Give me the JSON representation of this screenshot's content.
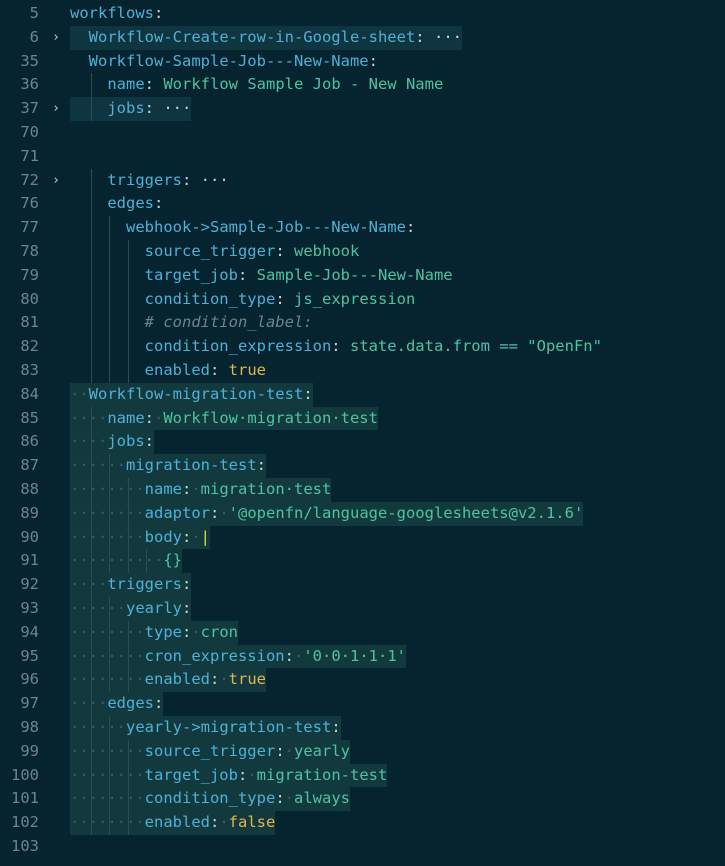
{
  "lines": [
    {
      "n": "5",
      "fold": "",
      "ind": 0,
      "k": "workflows",
      "v": "",
      "vt": "",
      "hl": false,
      "sel": false
    },
    {
      "n": "6",
      "fold": "›",
      "ind": 1,
      "k": "Workflow-Create-row-in-Google-sheet",
      "v": "···",
      "vt": "ell",
      "hl": true,
      "sel": false
    },
    {
      "n": "35",
      "fold": "",
      "ind": 1,
      "k": "Workflow-Sample-Job---New-Name",
      "v": "",
      "vt": "",
      "hl": false,
      "sel": false
    },
    {
      "n": "36",
      "fold": "",
      "ind": 2,
      "k": "name",
      "v": "Workflow Sample Job - New Name",
      "vt": "str",
      "hl": false,
      "sel": false
    },
    {
      "n": "37",
      "fold": "›",
      "ind": 2,
      "k": "jobs",
      "v": "···",
      "vt": "ell",
      "hl": true,
      "sel": false
    },
    {
      "n": "70",
      "fold": "",
      "ind": 0,
      "k": "",
      "v": "",
      "vt": "",
      "hl": true,
      "sel": false
    },
    {
      "n": "71",
      "fold": "",
      "ind": 0,
      "k": "",
      "v": "",
      "vt": "",
      "hl": false,
      "sel": false
    },
    {
      "n": "72",
      "fold": "›",
      "ind": 2,
      "k": "triggers",
      "v": "···",
      "vt": "ell",
      "hl": false,
      "sel": false
    },
    {
      "n": "76",
      "fold": "",
      "ind": 2,
      "k": "edges",
      "v": "",
      "vt": "",
      "hl": false,
      "sel": false
    },
    {
      "n": "77",
      "fold": "",
      "ind": 3,
      "k": "webhook->Sample-Job---New-Name",
      "v": "",
      "vt": "",
      "hl": false,
      "sel": false
    },
    {
      "n": "78",
      "fold": "",
      "ind": 4,
      "k": "source_trigger",
      "v": "webhook",
      "vt": "str",
      "hl": false,
      "sel": false
    },
    {
      "n": "79",
      "fold": "",
      "ind": 4,
      "k": "target_job",
      "v": "Sample-Job---New-Name",
      "vt": "str",
      "hl": false,
      "sel": false
    },
    {
      "n": "80",
      "fold": "",
      "ind": 4,
      "k": "condition_type",
      "v": "js_expression",
      "vt": "str",
      "hl": false,
      "sel": false
    },
    {
      "n": "81",
      "fold": "",
      "ind": 4,
      "k": "",
      "v": "# condition_label:",
      "vt": "cmt",
      "hl": false,
      "sel": false
    },
    {
      "n": "82",
      "fold": "",
      "ind": 4,
      "k": "condition_expression",
      "v": "state.data.from == \"OpenFn\"",
      "vt": "str",
      "hl": false,
      "sel": false
    },
    {
      "n": "83",
      "fold": "",
      "ind": 4,
      "k": "enabled",
      "v": "true",
      "vt": "bool",
      "hl": false,
      "sel": false
    },
    {
      "n": "84",
      "fold": "",
      "ind": 1,
      "k": "Workflow-migration-test",
      "v": "",
      "vt": "",
      "hl": false,
      "sel": true
    },
    {
      "n": "85",
      "fold": "",
      "ind": 2,
      "k": "name",
      "v": "Workflow migration test",
      "vt": "str",
      "hl": false,
      "sel": true
    },
    {
      "n": "86",
      "fold": "",
      "ind": 2,
      "k": "jobs",
      "v": "",
      "vt": "",
      "hl": false,
      "sel": true
    },
    {
      "n": "87",
      "fold": "",
      "ind": 3,
      "k": "migration-test",
      "v": "",
      "vt": "",
      "hl": false,
      "sel": true
    },
    {
      "n": "88",
      "fold": "",
      "ind": 4,
      "k": "name",
      "v": "migration test",
      "vt": "str",
      "hl": false,
      "sel": true
    },
    {
      "n": "89",
      "fold": "",
      "ind": 4,
      "k": "adaptor",
      "v": "'@openfn/language-googlesheets@v2.1.6'",
      "vt": "str",
      "hl": false,
      "sel": true
    },
    {
      "n": "90",
      "fold": "",
      "ind": 4,
      "k": "body",
      "v": "|",
      "vt": "pipe",
      "hl": false,
      "sel": true
    },
    {
      "n": "91",
      "fold": "",
      "ind": 5,
      "k": "",
      "v": "{}",
      "vt": "str",
      "hl": false,
      "sel": true
    },
    {
      "n": "92",
      "fold": "",
      "ind": 2,
      "k": "triggers",
      "v": "",
      "vt": "",
      "hl": false,
      "sel": true
    },
    {
      "n": "93",
      "fold": "",
      "ind": 3,
      "k": "yearly",
      "v": "",
      "vt": "",
      "hl": false,
      "sel": true
    },
    {
      "n": "94",
      "fold": "",
      "ind": 4,
      "k": "type",
      "v": "cron",
      "vt": "str",
      "hl": false,
      "sel": true
    },
    {
      "n": "95",
      "fold": "",
      "ind": 4,
      "k": "cron_expression",
      "v": "'0 0 1 1 1'",
      "vt": "str",
      "hl": false,
      "sel": true
    },
    {
      "n": "96",
      "fold": "",
      "ind": 4,
      "k": "enabled",
      "v": "true",
      "vt": "bool",
      "hl": false,
      "sel": true
    },
    {
      "n": "97",
      "fold": "",
      "ind": 2,
      "k": "edges",
      "v": "",
      "vt": "",
      "hl": false,
      "sel": true
    },
    {
      "n": "98",
      "fold": "",
      "ind": 3,
      "k": "yearly->migration-test",
      "v": "",
      "vt": "",
      "hl": false,
      "sel": true
    },
    {
      "n": "99",
      "fold": "",
      "ind": 4,
      "k": "source_trigger",
      "v": "yearly",
      "vt": "str",
      "hl": false,
      "sel": true
    },
    {
      "n": "100",
      "fold": "",
      "ind": 4,
      "k": "target_job",
      "v": "migration-test",
      "vt": "str",
      "hl": false,
      "sel": true
    },
    {
      "n": "101",
      "fold": "",
      "ind": 4,
      "k": "condition_type",
      "v": "always",
      "vt": "str",
      "hl": false,
      "sel": true
    },
    {
      "n": "102",
      "fold": "",
      "ind": 4,
      "k": "enabled",
      "v": "false",
      "vt": "bool",
      "hl": false,
      "sel": true
    },
    {
      "n": "103",
      "fold": "",
      "ind": 0,
      "k": "",
      "v": "",
      "vt": "",
      "hl": false,
      "sel": false
    }
  ],
  "colors": {
    "background": "#06242f",
    "key": "#4fb0d8",
    "string": "#4fc3a1",
    "boolean": "#e0b64a",
    "comment": "#6a858c",
    "line_number": "#6f848b"
  }
}
